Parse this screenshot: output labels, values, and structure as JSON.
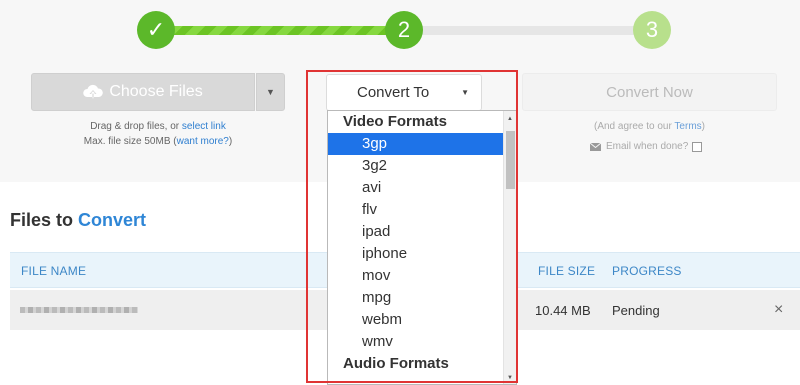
{
  "steps": [
    {
      "label": "✓",
      "state": "done"
    },
    {
      "label": "2",
      "state": "current"
    },
    {
      "label": "3",
      "state": "upcoming"
    }
  ],
  "choose": {
    "button_label": "Choose Files",
    "hint_prefix": "Drag & drop files, or ",
    "hint_link": "select link",
    "size_prefix": "Max. file size 50MB (",
    "size_link": "want more?",
    "size_suffix": ")"
  },
  "convert_to": {
    "label": "Convert To"
  },
  "convert_now": {
    "label": "Convert Now",
    "agree_prefix": "(And agree to our ",
    "agree_link": "Terms",
    "agree_suffix": ")",
    "email_label": "Email when done?"
  },
  "files": {
    "title_prefix": "Files to ",
    "title_accent": "Convert",
    "columns": {
      "name": "FILE NAME",
      "size": "FILE SIZE",
      "progress": "PROGRESS"
    },
    "rows": [
      {
        "size": "10.44 MB",
        "progress": "Pending",
        "remove": "×"
      }
    ]
  },
  "dropdown": {
    "groups": [
      {
        "label": "Video Formats",
        "items": [
          "3gp",
          "3g2",
          "avi",
          "flv",
          "ipad",
          "iphone",
          "mov",
          "mpg",
          "webm",
          "wmv"
        ]
      },
      {
        "label": "Audio Formats",
        "items": []
      }
    ],
    "selected": "3gp"
  },
  "colors": {
    "step_done": "#5cb82a",
    "step_upcoming": "#b8e08c",
    "accent_blue": "#2f86d6",
    "selection": "#1e73e8",
    "highlight": "#e03434"
  }
}
